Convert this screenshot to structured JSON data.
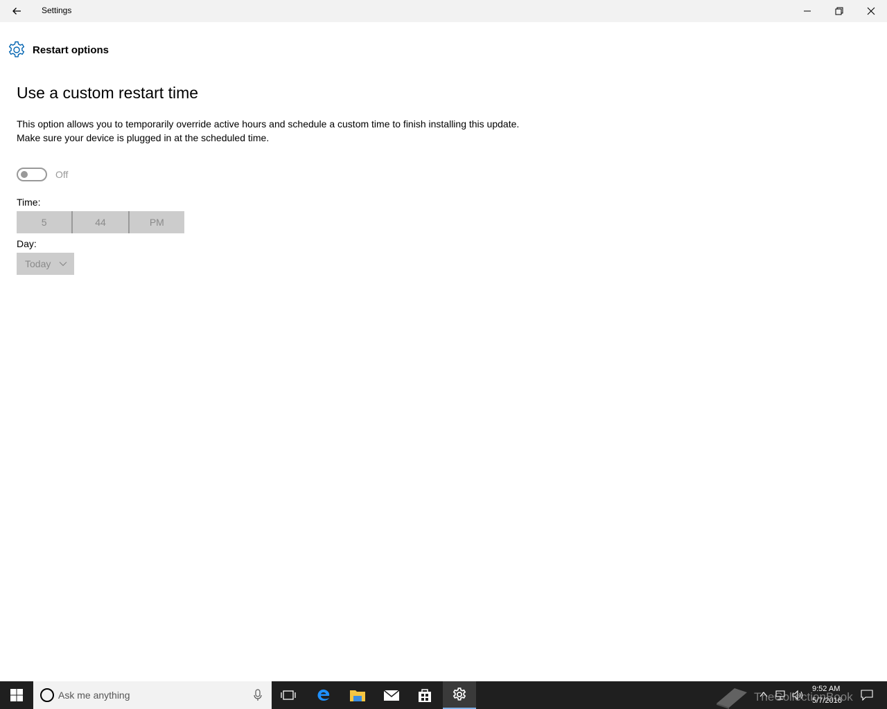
{
  "window": {
    "title": "Settings"
  },
  "header": {
    "title": "Restart options",
    "icon": "gear-icon",
    "accent_color": "#0063b1"
  },
  "main": {
    "heading": "Use a custom restart time",
    "description_line1": "This option allows you to temporarily override active hours and schedule a custom time to finish installing this update.",
    "description_line2": "Make sure your device is plugged in at the scheduled time.",
    "toggle": {
      "state_label": "Off",
      "on": false
    },
    "time": {
      "label": "Time:",
      "hour": "5",
      "minute": "44",
      "period": "PM"
    },
    "day": {
      "label": "Day:",
      "selected": "Today"
    }
  },
  "taskbar": {
    "search_placeholder": "Ask me anything",
    "apps": [
      "task-view-icon",
      "edge-icon",
      "file-explorer-icon",
      "mail-icon",
      "store-icon",
      "settings-icon"
    ],
    "active_app": "settings-icon",
    "clock_time": "9:52 AM",
    "clock_date": "5/7/2016"
  },
  "watermark": {
    "text": "TheCollectionBook"
  }
}
